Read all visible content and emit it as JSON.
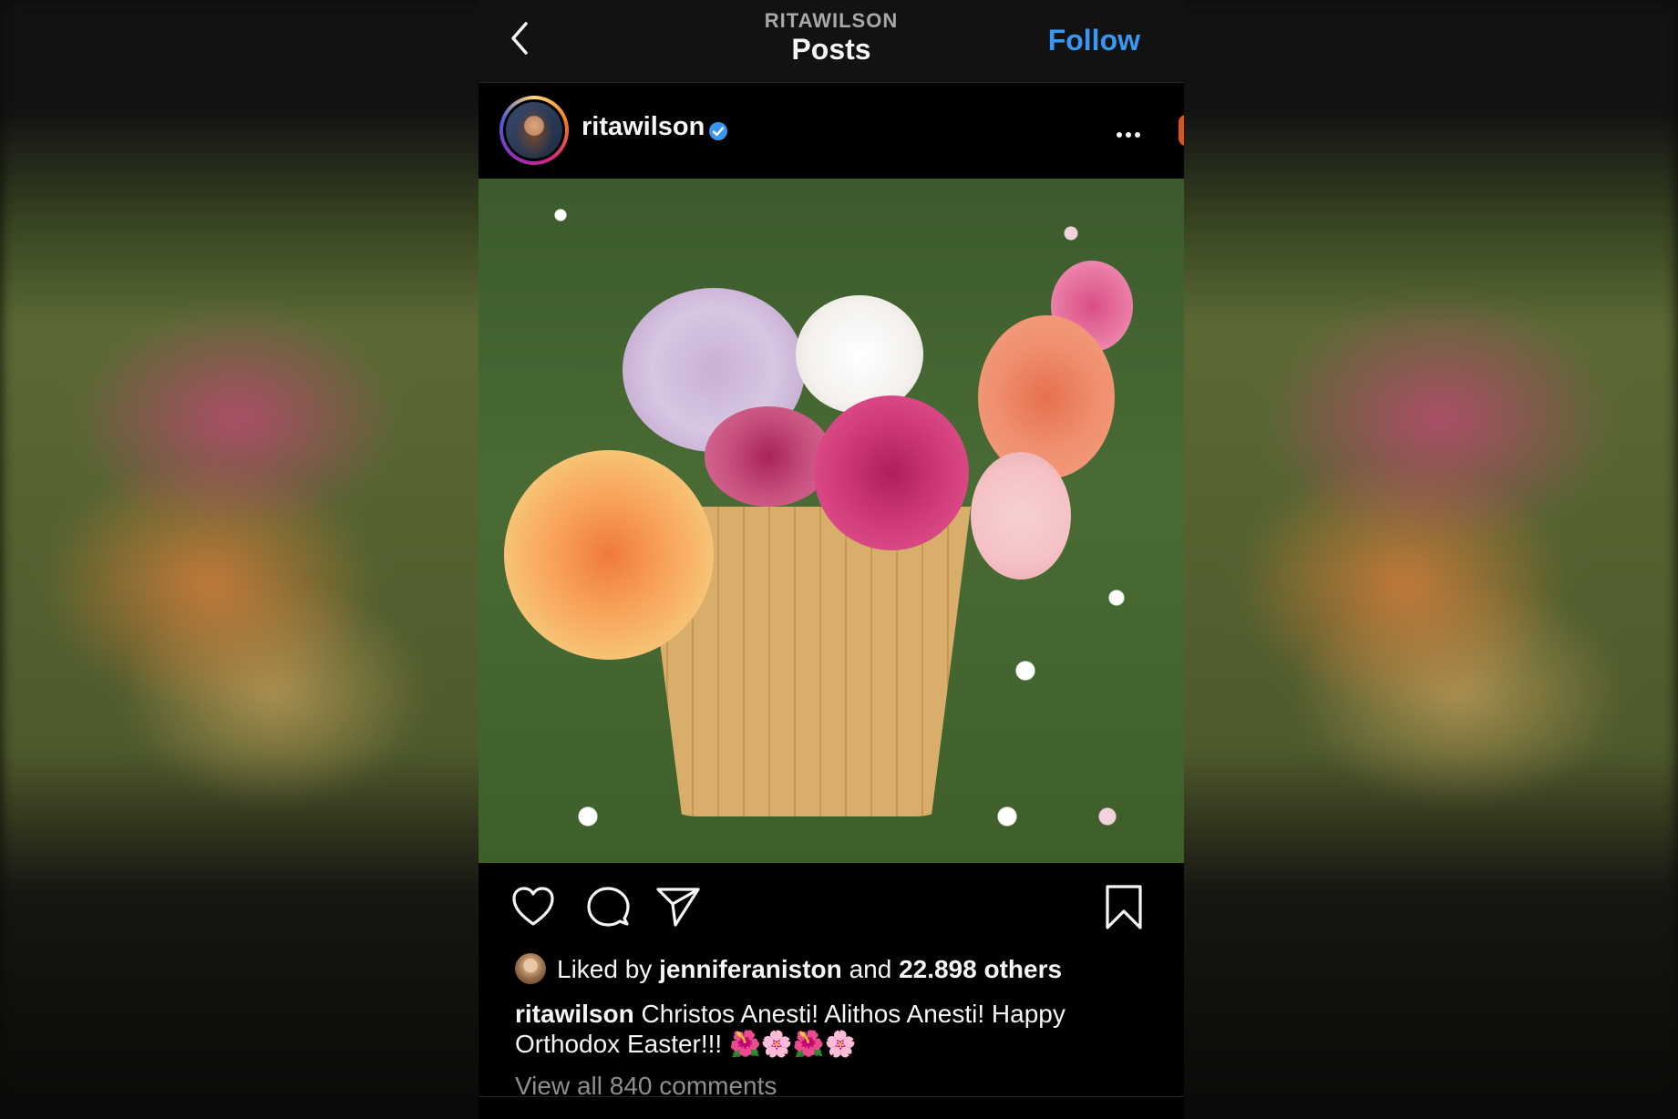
{
  "header": {
    "account_label": "RITAWILSON",
    "title": "Posts",
    "follow_label": "Follow"
  },
  "post": {
    "username": "ritawilson",
    "verified": true,
    "likes": {
      "prefix": "Liked by",
      "liker": "jenniferaniston",
      "joiner": "and",
      "others": "22.898 others"
    },
    "caption_user": "ritawilson",
    "caption_text": "Christos Anesti! Alithos Anesti! Happy Orthodox Easter!!! 🌺🌸🌺🌸",
    "view_comments": "View all 840 comments"
  },
  "colors": {
    "accent": "#3897f0",
    "background": "#000000",
    "topbar": "#121212"
  }
}
